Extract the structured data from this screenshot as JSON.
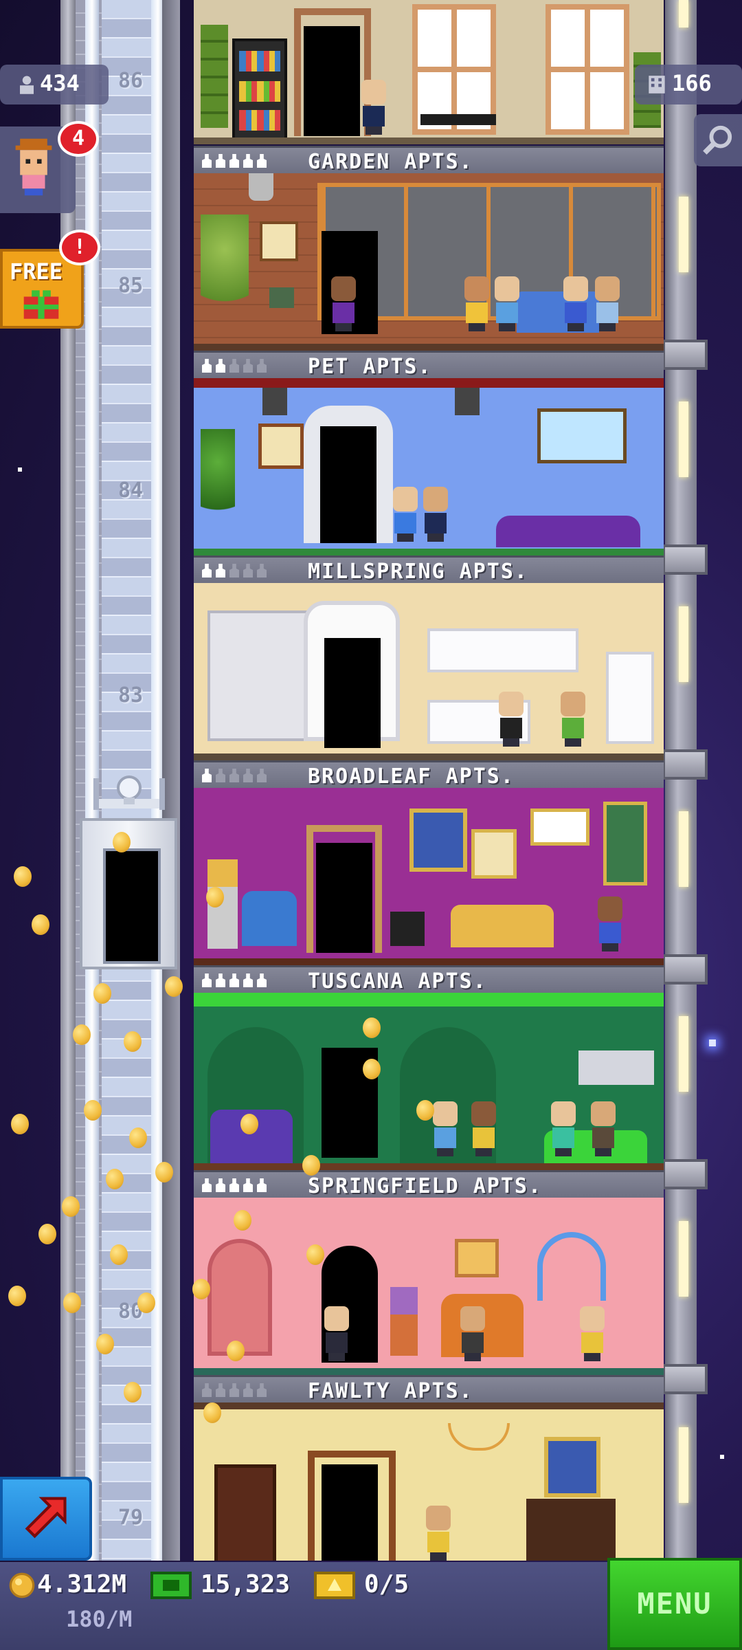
{
  "hud": {
    "population": "434",
    "population_icon": "person-icon",
    "floors": "166",
    "floors_icon": "building-icon",
    "resident_badge": "4",
    "free_label": "FREE",
    "free_badge": "!"
  },
  "floor_numbers": [
    "86",
    "85",
    "84",
    "83",
    "80",
    "79"
  ],
  "floors": [
    {
      "name": "GARDEN APTS.",
      "stars": 5
    },
    {
      "name": "PET APTS.",
      "stars": 2
    },
    {
      "name": "MILLSPRING APTS.",
      "stars": 2
    },
    {
      "name": "BROADLEAF APTS.",
      "stars": 1
    },
    {
      "name": "TUSCANA APTS.",
      "stars": 5
    },
    {
      "name": "SPRINGFIELD APTS.",
      "stars": 5
    },
    {
      "name": "FAWLTY APTS.",
      "stars": 0
    }
  ],
  "bottom_bar": {
    "coins": "4.312M",
    "coins_rate": "180/M",
    "bux": "15,323",
    "tickets": "0/5",
    "menu_label": "MENU"
  },
  "colors": {
    "accent_green": "#2fc21f",
    "badge_red": "#e0212b",
    "coin_gold": "#f0b93a",
    "sky": "#24184f"
  }
}
